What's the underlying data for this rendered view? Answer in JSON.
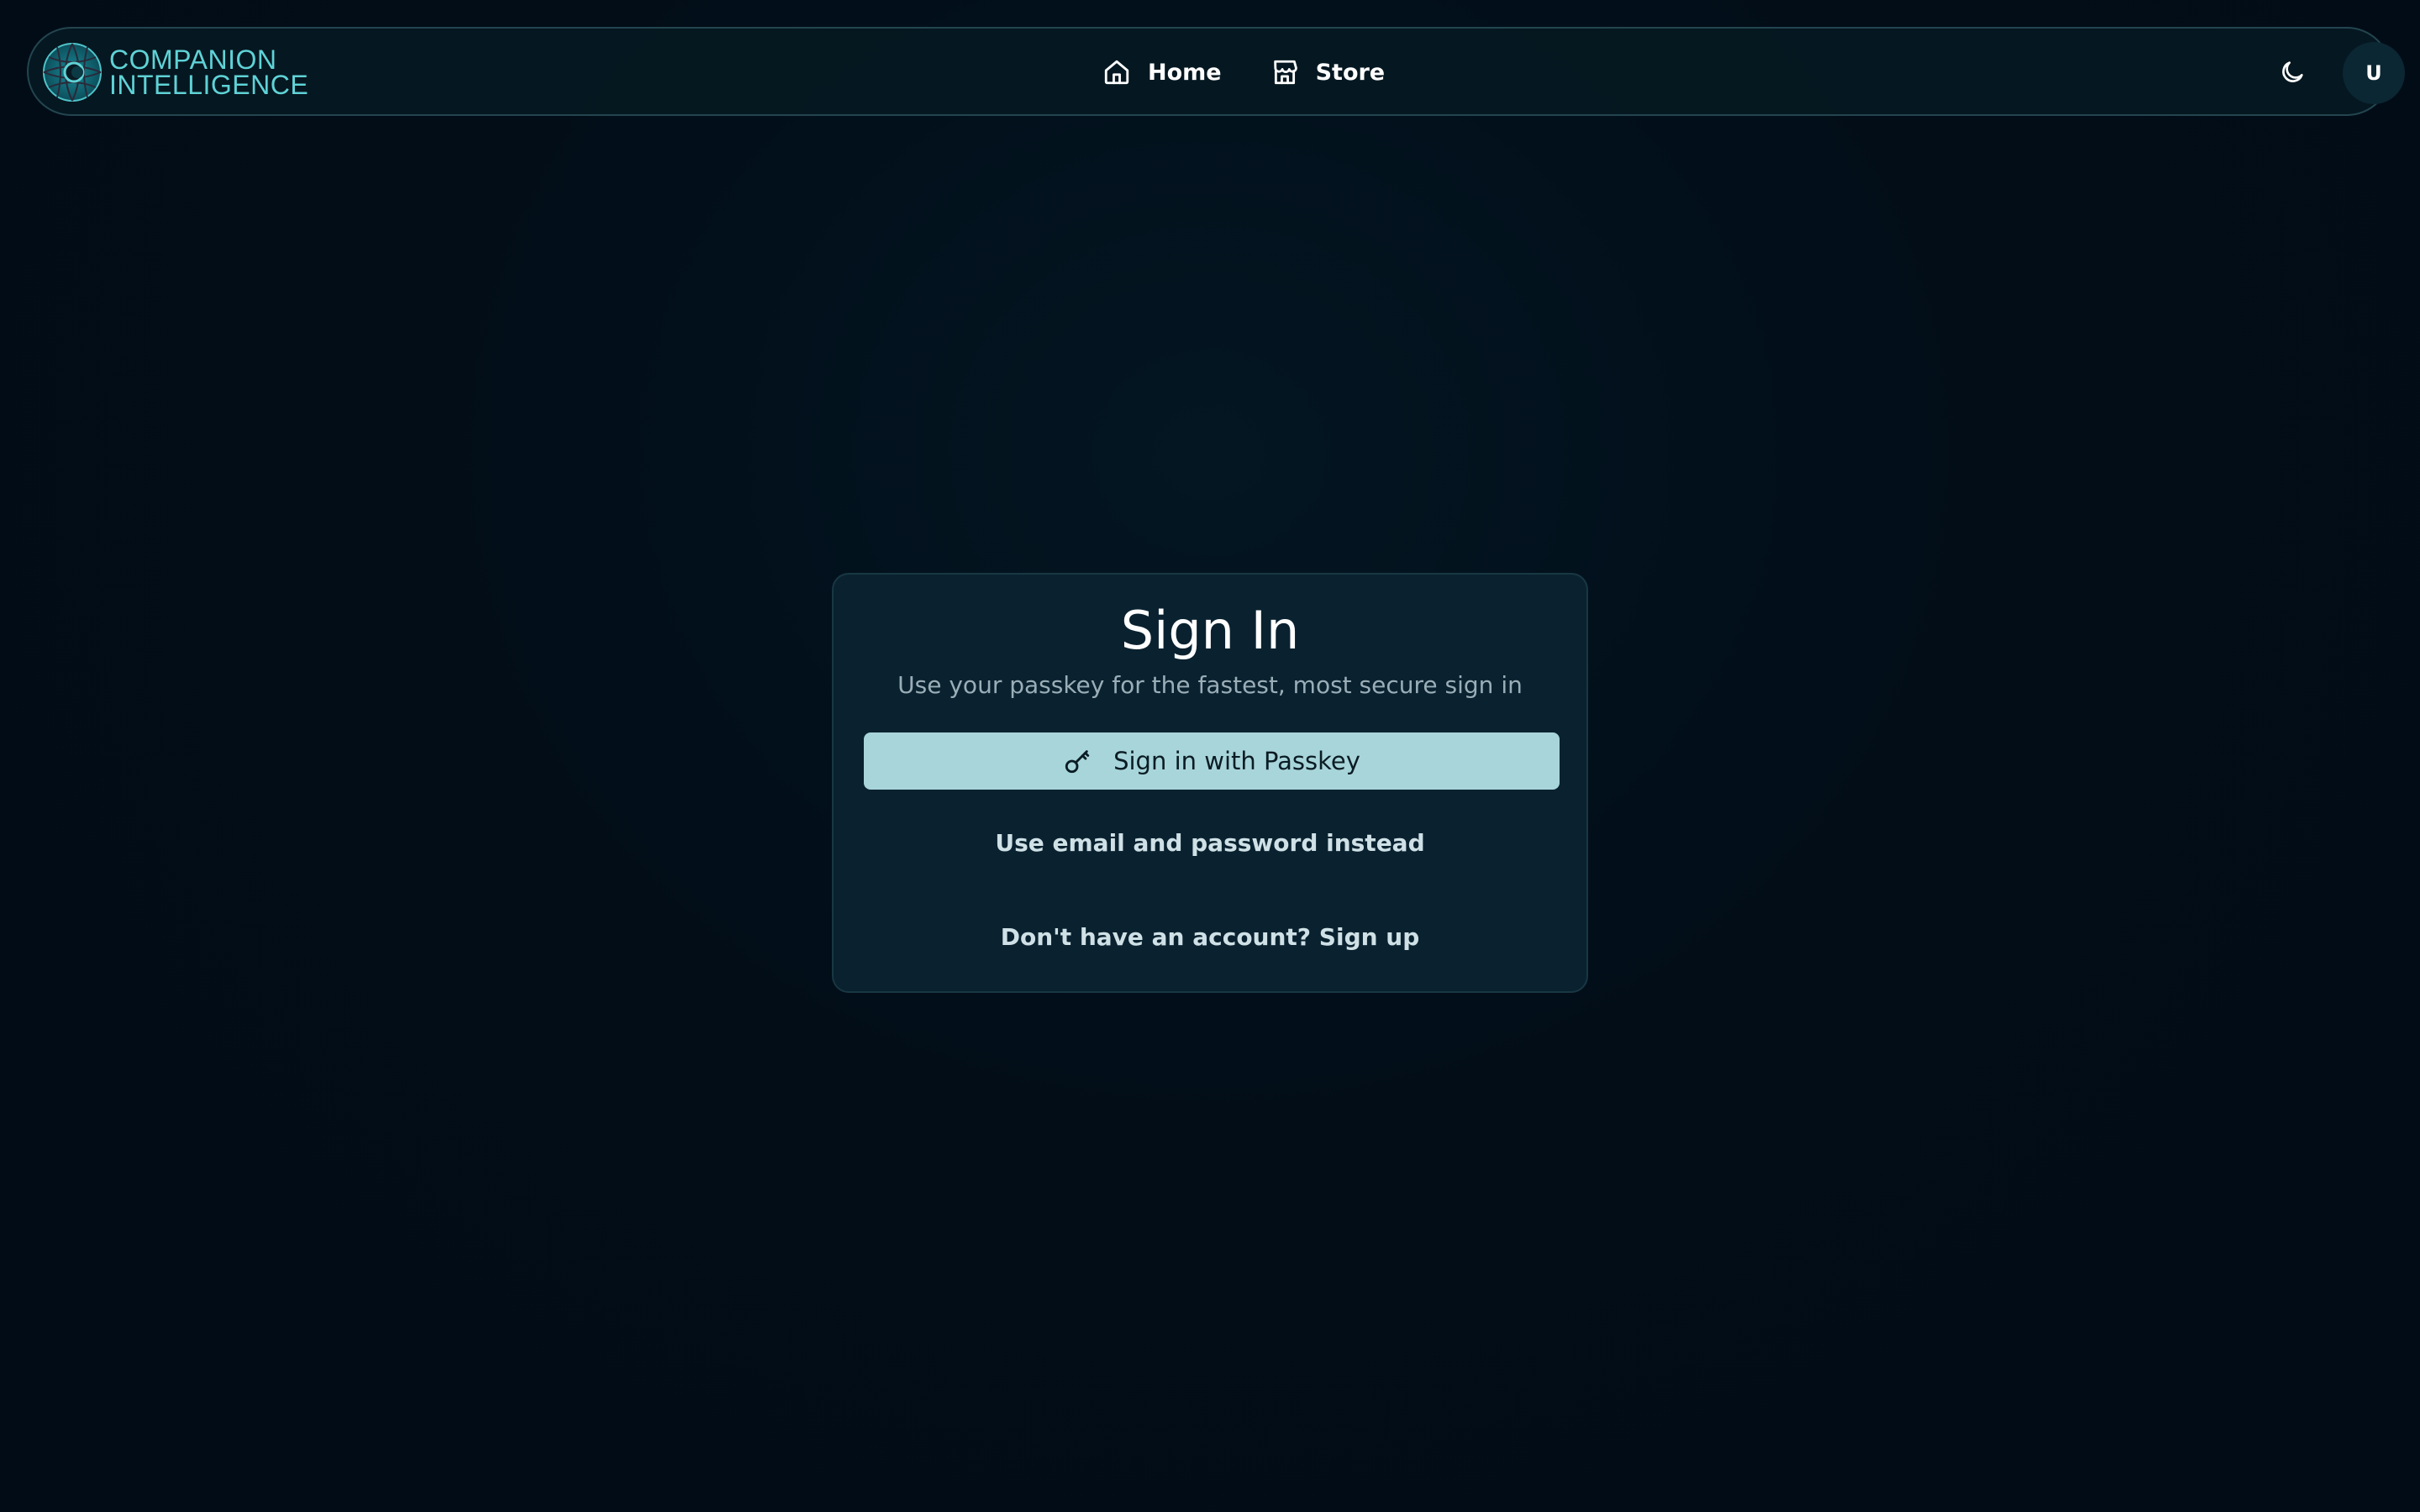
{
  "brand": {
    "line1": "COMPANION",
    "line2": "INTELLIGENCE",
    "icon": "companion-logo-icon",
    "color": "#5fd2d6"
  },
  "nav": {
    "items": [
      {
        "label": "Home",
        "icon": "home-icon"
      },
      {
        "label": "Store",
        "icon": "store-icon"
      }
    ]
  },
  "header": {
    "theme_toggle_icon": "moon-icon",
    "avatar_initial": "U"
  },
  "signin": {
    "title": "Sign In",
    "subtitle": "Use your passkey for the fastest, most secure sign in",
    "passkey_button": "Sign in with Passkey",
    "passkey_icon": "key-icon",
    "email_link": "Use email and password instead",
    "signup_link": "Don't have an account? Sign up"
  },
  "colors": {
    "background": "#020d18",
    "card": "#0a2230",
    "primary_button": "#a8d5da",
    "muted_text": "#9aaeb7"
  }
}
